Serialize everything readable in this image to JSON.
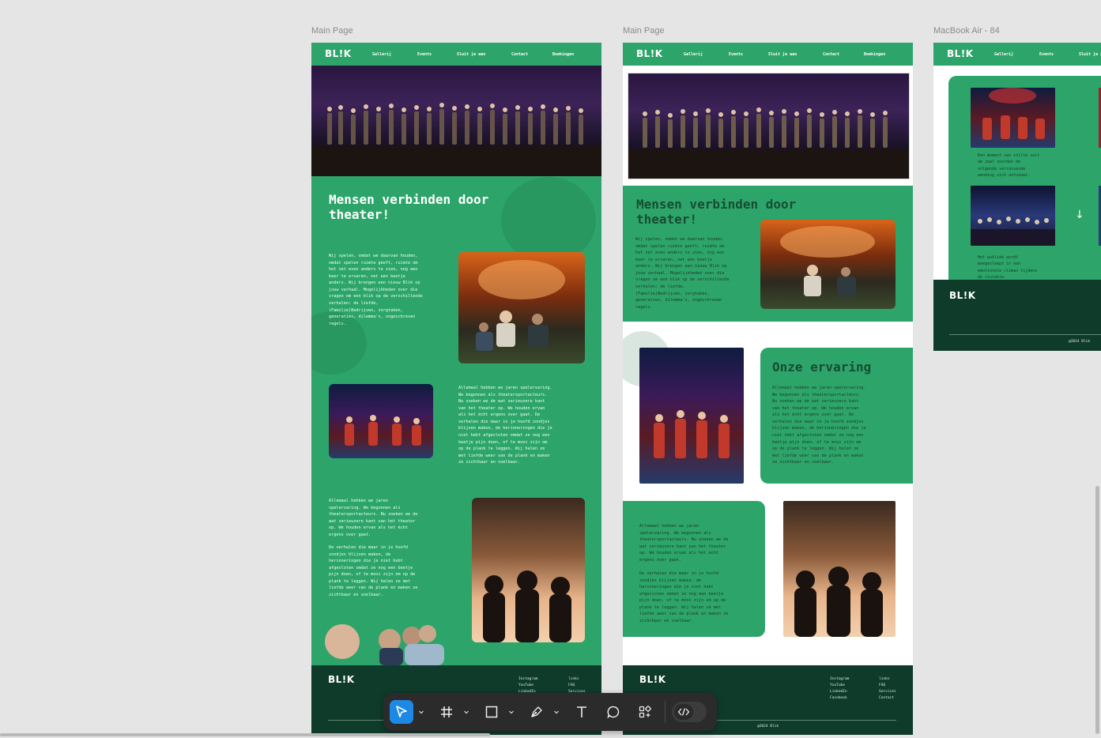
{
  "frames": {
    "a_label": "Main Page",
    "b_label": "Main Page",
    "c_label": "MacBook Air - 84"
  },
  "nav": {
    "logo": "BL!K",
    "items": [
      "Gallerij",
      "Events",
      "Sluit je aan",
      "Contact",
      "Boekingen"
    ]
  },
  "hero": {
    "headline_line1": "Mensen verbinden door",
    "headline_line2": "theater!",
    "intro": "Wij spelen, omdat we daarvan houden,\nomdat spelen ruimte geeft, ruimte om\nhet net even anders te zien, nog een\nkeer te ervaren, net een beetje\nanders. Wij brengen een nieuw Blik op\njouw verhaal. Mogelijkheden over die\nvragen om een blik op de verschillende\nverhalen: de liefde,\n(Familie)Bedrijven, zorgtaken,\ngeneraties, dilemma's, ongeschreven\nregels."
  },
  "experience": {
    "title": "Onze ervaring",
    "text": "Allemaal hebben we jaren spelervaring.\nWe begonnen als theatersportacteurs.\nNu zoeken we de wat serieuzere kant\nvan het theater op. We houden ervan\nals het écht ergens over gaat. De\nverhalen die maar in je hoofd zondjes\nblijven maken, de herinneringen die je\nniet hebt afgesloten omdat ze nog een\nbeetje pijn doen, of te mooi zijn om\nop de plank te leggen. Wij halen ze\nmet liefde weer van de plank en maken\nze zichtbaar en voelbaar.",
    "text_a": "Allemaal hebben we jaren\nspelervaring. We begonnen als\ntheatersportacteurs. Nu zoeken we de\nwat serieuzere kant van het theater\nop. We houden ervan als het écht\nergens over gaat.",
    "text_b": "De verhalen die maar in je hoofd\nzondjes blijven maken, de\nherinneringen die je niet hebt\nafgesloten omdat ze nog een beetje\npijn doen, of te mooi zijn om op de\nplank te leggen. Wij halen ze met\nliefde weer van de plank en maken ze\nzichtbaar en voelbaar."
  },
  "gallery": {
    "caption1": "Een moment van stilte vult\nde zaal voordat de\nvolgende verrassende\nwending zich ontvouwt.",
    "caption2": "Het publiek wordt\nmeegesleept in een\nemotionele climax tijdens\nde slotakte."
  },
  "footer": {
    "logo": "BL!K",
    "col1": [
      "Instagram",
      "YouTube",
      "LinkedIn",
      "Facebook"
    ],
    "col2": [
      "links",
      "FAQ",
      "Services",
      "Contact"
    ],
    "copyright": "@2024 Blik"
  },
  "colors": {
    "brand_green": "#2da56a",
    "footer_dark": "#0f3b2b",
    "canvas": "#e5e5e5",
    "tool_active": "#1e88e5"
  },
  "toolbar": {
    "tools": [
      "move-tool",
      "frame-tool",
      "rectangle-tool",
      "pen-tool",
      "text-tool",
      "comment-tool",
      "components-tool",
      "dev-mode-toggle"
    ]
  }
}
